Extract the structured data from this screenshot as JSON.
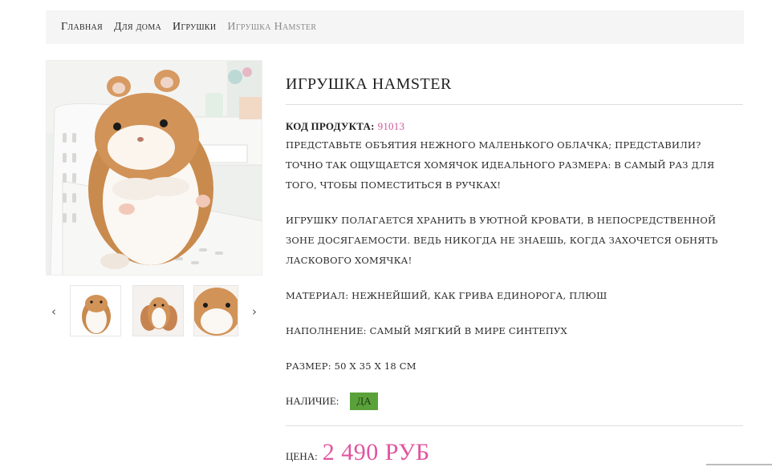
{
  "breadcrumb": {
    "items": [
      "Главная",
      "Для дома",
      "Игрушки"
    ],
    "current": "Игрушка Hamster"
  },
  "gallery": {
    "main_image": "plush-hamster-toy-on-white-chair",
    "thumbnails": [
      "hamster-front-thumb",
      "hamster-cluster-thumb",
      "hamster-closeup-thumb"
    ],
    "prev_icon": "‹",
    "next_icon": "›"
  },
  "product": {
    "title": "ИГРУШКА HAMSTER",
    "code_label": "КОД ПРОДУКТА:",
    "code_value": "91013",
    "description_lines_1": [
      "ПРЕДСТАВЬТЕ ОБЪЯТИЯ НЕЖНОГО МАЛЕНЬКОГО ОБЛАЧКА;  ПРЕДСТАВИЛИ?",
      "ТОЧНО ТАК ОЩУЩАЕТСЯ ХОМЯЧОК ИДЕАЛЬНОГО РАЗМЕРА: В САМЫЙ РАЗ ДЛЯ",
      "ТОГО, ЧТОБЫ ПОМЕСТИТЬСЯ В РУЧКАХ!"
    ],
    "description_lines_2": [
      "ИГРУШКУ ПОЛАГАЕТСЯ ХРАНИТЬ В УЮТНОЙ КРОВАТИ, В НЕПОСРЕДСТВЕННОЙ",
      "ЗОНЕ ДОСЯГАЕМОСТИ. ВЕДЬ НИКОГДА НЕ ЗНАЕШЬ, КОГДА ЗАХОЧЕТСЯ ОБНЯТЬ",
      "ЛАСКОВОГО ХОМЯЧКА!"
    ],
    "material": "МАТЕРИАЛ: НЕЖНЕЙШИЙ, КАК ГРИВА ЕДИНОРОГА, ПЛЮШ",
    "filling": "НАПОЛНЕНИЕ: САМЫЙ МЯГКИЙ В МИРЕ СИНТЕПУХ",
    "size": "РАЗМЕР: 50 Х 35 Х 18 СМ",
    "availability_label": "НАЛИЧИЕ:",
    "availability_value": "ДА",
    "price_label": "ЦЕНА:",
    "price_value": "2 490 РУБ"
  },
  "colors": {
    "accent_pink": "#e0559f",
    "code_pink": "#d2569c",
    "badge_green": "#5aa13a",
    "breadcrumb_bg": "#f5f5f5"
  }
}
